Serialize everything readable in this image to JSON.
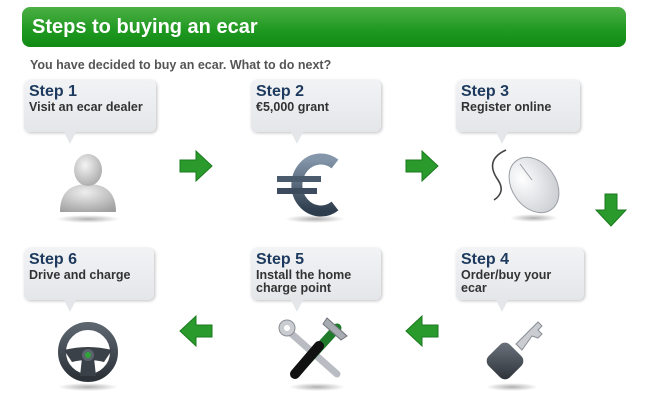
{
  "header": {
    "title": "Steps to buying an ecar"
  },
  "intro": "You have decided to buy an ecar. What to do next?",
  "steps": [
    {
      "title": "Step 1",
      "desc": "Visit an ecar dealer",
      "icon": "person-icon"
    },
    {
      "title": "Step 2",
      "desc": "€5,000 grant",
      "icon": "euro-icon"
    },
    {
      "title": "Step 3",
      "desc": "Register online",
      "icon": "mouse-icon"
    },
    {
      "title": "Step 4",
      "desc": "Order/buy your ecar",
      "icon": "car-key-icon"
    },
    {
      "title": "Step 5",
      "desc": "Install the home charge point",
      "icon": "tools-icon"
    },
    {
      "title": "Step 6",
      "desc": "Drive and charge",
      "icon": "steering-wheel-icon"
    }
  ],
  "colors": {
    "banner": "#219a22",
    "arrow": "#2a9a2c",
    "step_title": "#1d3a5e"
  }
}
